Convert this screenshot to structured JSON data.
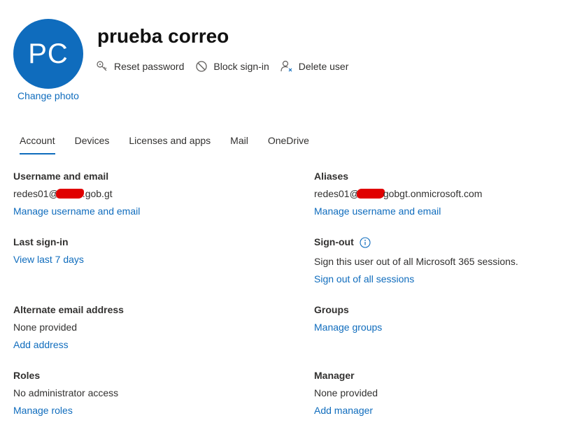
{
  "profile": {
    "initials": "PC",
    "change_photo": "Change photo",
    "display_name": "prueba correo"
  },
  "actions": {
    "reset_password": "Reset password",
    "block_signin": "Block sign-in",
    "delete_user": "Delete user"
  },
  "tabs": [
    {
      "label": "Account"
    },
    {
      "label": "Devices"
    },
    {
      "label": "Licenses and apps"
    },
    {
      "label": "Mail"
    },
    {
      "label": "OneDrive"
    }
  ],
  "account": {
    "username": {
      "heading": "Username and email",
      "prefix": "redes01@",
      "suffix": ".gob.gt",
      "link": "Manage username and email"
    },
    "aliases": {
      "heading": "Aliases",
      "prefix": "redes01@",
      "suffix": "gobgt.onmicrosoft.com",
      "link": "Manage username and email"
    },
    "last_signin": {
      "heading": "Last sign-in",
      "link": "View last 7 days"
    },
    "signout": {
      "heading": "Sign-out",
      "text": "Sign this user out of all Microsoft 365 sessions.",
      "link": "Sign out of all sessions"
    },
    "alt_email": {
      "heading": "Alternate email address",
      "value": "None provided",
      "link": "Add address"
    },
    "groups": {
      "heading": "Groups",
      "link": "Manage groups"
    },
    "roles": {
      "heading": "Roles",
      "value": "No administrator access",
      "link": "Manage roles"
    },
    "manager": {
      "heading": "Manager",
      "value": "None provided",
      "link": "Add manager"
    }
  },
  "colors": {
    "accent": "#0f6cbd",
    "text": "#323130",
    "redaction": "#e00000"
  }
}
